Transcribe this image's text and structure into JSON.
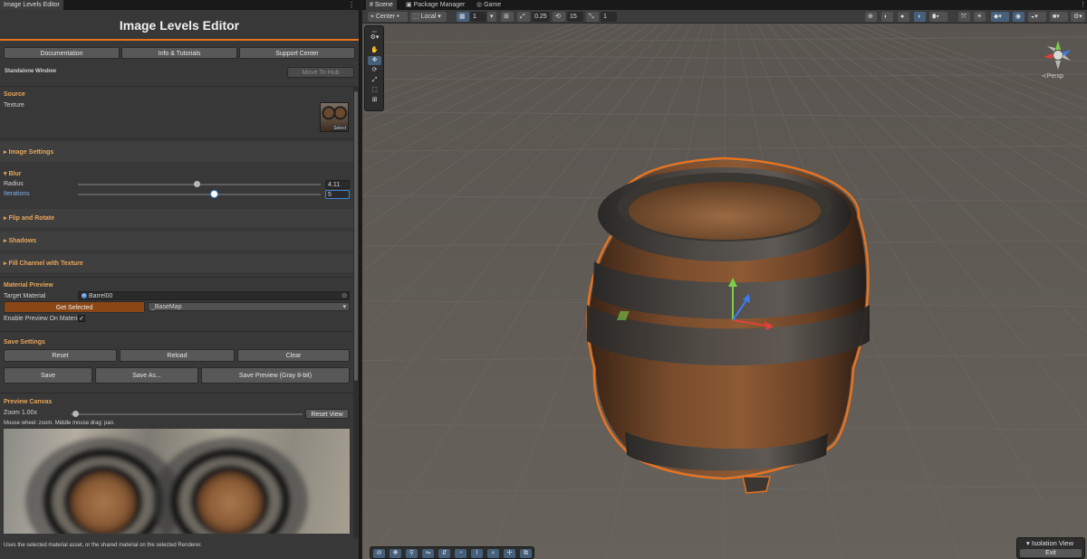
{
  "left_panel": {
    "tab_title": "Image Levels Editor",
    "header_title": "Image Levels Editor",
    "links": {
      "documentation": "Documentation",
      "tutorials": "Info & Tutorials",
      "support": "Support Center"
    },
    "standalone_label": "Standalone Window",
    "move_to_hub": "Move To Hub",
    "source": {
      "title": "Source",
      "texture_label": "Texture",
      "select_label": "Select"
    },
    "sections": {
      "image_settings": "Image Settings",
      "blur": "Blur",
      "flip_rotate": "Flip and Rotate",
      "shadows": "Shadows",
      "fill_channel": "Fill Channel with Texture"
    },
    "blur": {
      "radius_label": "Radius",
      "radius_value": "4.11",
      "radius_fraction": 0.49,
      "iterations_label": "Iterations",
      "iterations_value": "5",
      "iterations_fraction": 0.56
    },
    "material_preview": {
      "title": "Material Preview",
      "target_label": "Target Material",
      "target_value": "Barrel00",
      "get_selected": "Get Selected",
      "property_value": "_BaseMap",
      "enable_label": "Enable Preview On Material",
      "enable_checked": "✓"
    },
    "save_settings": {
      "title": "Save Settings",
      "reset": "Reset",
      "reload": "Reload",
      "clear": "Clear",
      "save": "Save",
      "save_as": "Save As...",
      "save_preview": "Save Preview (Gray 8-bit)"
    },
    "preview_canvas": {
      "title": "Preview Canvas",
      "zoom_label": "Zoom 1.00x",
      "zoom_fraction": 0.02,
      "reset_view": "Reset View",
      "hint": "Mouse wheel: zoom. Middle mouse drag: pan."
    },
    "footer_hint": "Uses the selected material asset, or the shared material on the selected Renderer."
  },
  "scene": {
    "tabs": [
      "Scene",
      "Package Manager",
      "Game"
    ],
    "toolbar": {
      "pivot": "Center",
      "space": "Local",
      "grid_value": "1",
      "snap_value": "0.25",
      "rotate_snap": "15",
      "scale_snap": "1"
    },
    "persp_label": "Persp",
    "isolation_title": "Isolation View",
    "isolation_exit": "Exit",
    "colors": {
      "selection_outline": "#e8731e",
      "accent": "#46607c",
      "axis_x": "#e0403a",
      "axis_y": "#7ad04a",
      "axis_z": "#3a7cf0"
    }
  }
}
